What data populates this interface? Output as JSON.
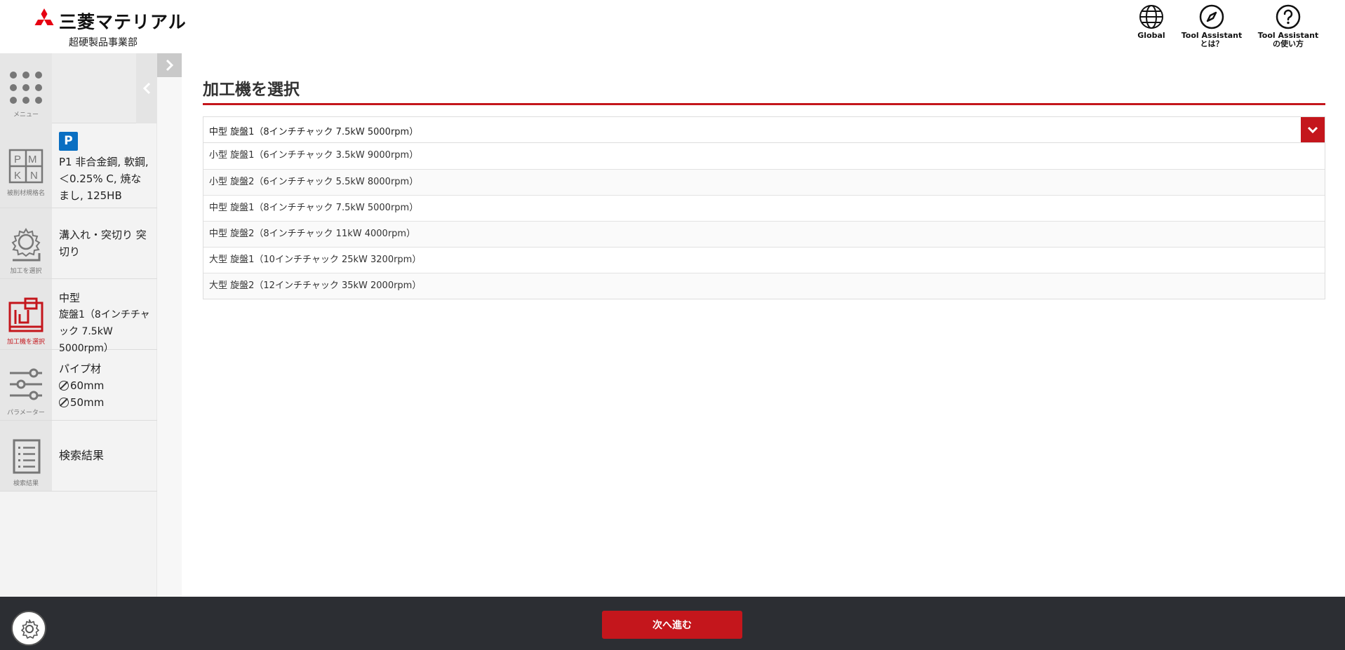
{
  "header": {
    "brand_name": "三菱マテリアル",
    "brand_sub": "超硬製品事業部",
    "buttons": [
      {
        "label": "Global",
        "icon": "globe-icon"
      },
      {
        "label": "Tool Assistant\nとは？",
        "icon": "compass-icon"
      },
      {
        "label": "Tool Assistant\nの使い方",
        "icon": "help-icon"
      }
    ]
  },
  "sidebar": {
    "menu_label": "メニュー",
    "steps": [
      {
        "caption": "被削材規格名",
        "badge": "P",
        "text": "P1 非合金鋼, 軟鋼, ＜0.25% C, 焼なまし, 125HB"
      },
      {
        "caption": "加工を選択",
        "text": "溝入れ・突切り 突切り"
      },
      {
        "caption": "加工機を選択",
        "line1": "中型",
        "line2": "旋盤1（8インチチャック 7.5kW 5000rpm）",
        "active": true
      },
      {
        "caption": "パラメーター",
        "line1": "パイプ材",
        "d1": "60mm",
        "d2": "50mm"
      },
      {
        "caption": "検索結果",
        "text": "検索結果"
      }
    ]
  },
  "main": {
    "title": "加工機を選択",
    "selected": "中型 旋盤1（8インチチャック 7.5kW 5000rpm）",
    "options": [
      "小型 旋盤1（6インチチャック 3.5kW 9000rpm）",
      "小型 旋盤2（6インチチャック 5.5kW 8000rpm）",
      "中型 旋盤1（8インチチャック 7.5kW 5000rpm）",
      "中型 旋盤2（8インチチャック 11kW 4000rpm）",
      "大型 旋盤1（10インチチャック 25kW 3200rpm）",
      "大型 旋盤2（12インチチャック 35kW 2000rpm）"
    ]
  },
  "footer": {
    "next_label": "次へ進む",
    "settings_icon": "gear-icon"
  },
  "colors": {
    "accent": "#c4161c",
    "badge_blue": "#0a6fc2",
    "footer_bg": "#2c2e33"
  }
}
